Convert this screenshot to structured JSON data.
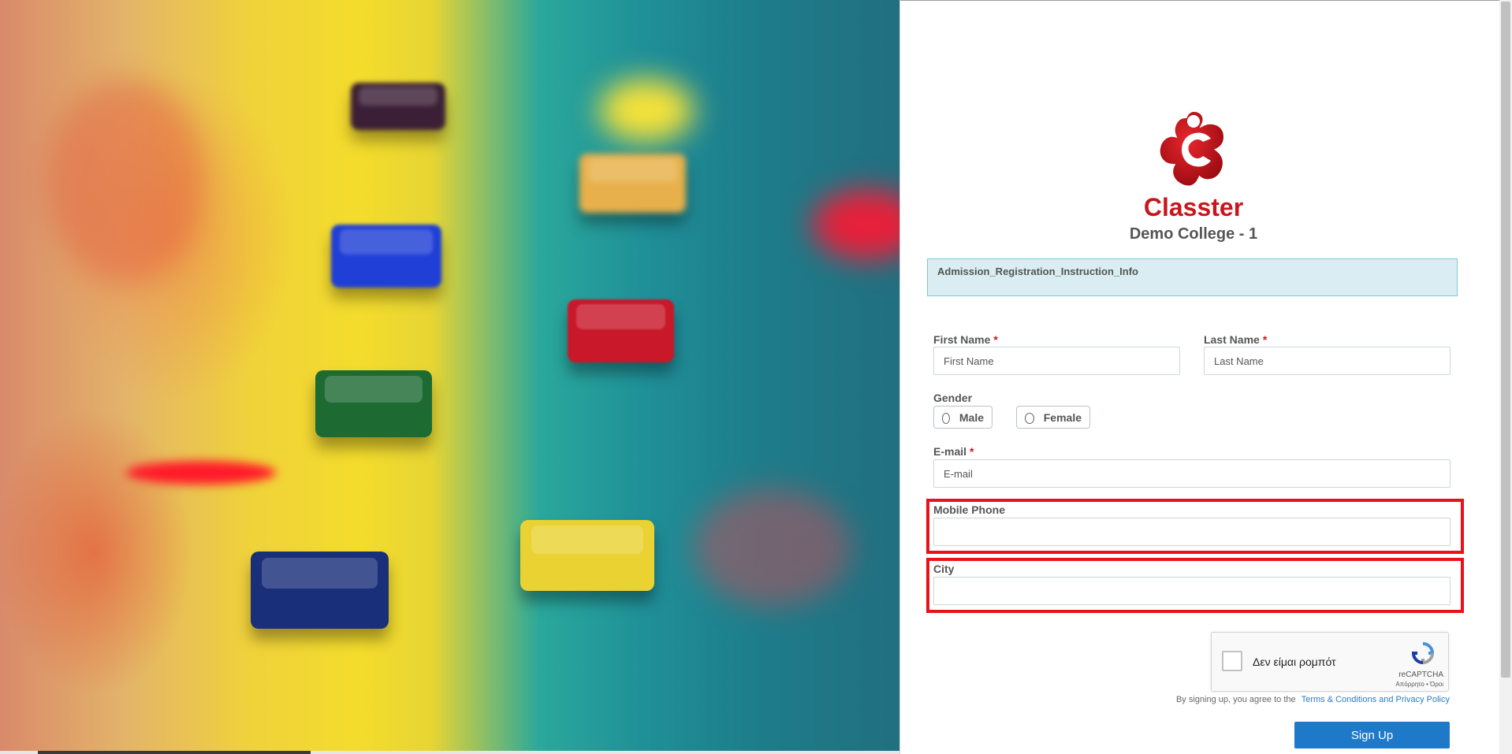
{
  "brand": {
    "name": "Classter",
    "college": "Demo College - 1",
    "accent": "#c8161d"
  },
  "info": {
    "text": "Admission_Registration_Instruction_Info"
  },
  "form": {
    "first_name": {
      "label": "First Name",
      "required": "*",
      "placeholder": "First Name",
      "value": ""
    },
    "last_name": {
      "label": "Last Name",
      "required": "*",
      "placeholder": "Last Name",
      "value": ""
    },
    "gender": {
      "label": "Gender",
      "options": [
        "Male",
        "Female"
      ],
      "selected": ""
    },
    "email": {
      "label": "E-mail",
      "required": "*",
      "placeholder": "E-mail",
      "value": ""
    },
    "mobile_phone": {
      "label": "Mobile Phone",
      "placeholder": "",
      "value": "",
      "highlighted": true
    },
    "city": {
      "label": "City",
      "placeholder": "",
      "value": "",
      "highlighted": true
    }
  },
  "captcha": {
    "checkbox_label": "Δεν είμαι ρομπότ",
    "brand": "reCAPTCHA",
    "links": "Απόρρητο • Όροι"
  },
  "terms": {
    "prefix": "By signing up, you agree to the",
    "link_text": "Terms & Conditions and Privacy Policy"
  },
  "signup_button": "Sign Up",
  "colors": {
    "highlight": "#e8121a",
    "primary_button": "#1e7ac8",
    "info_background": "#d9edf2"
  }
}
